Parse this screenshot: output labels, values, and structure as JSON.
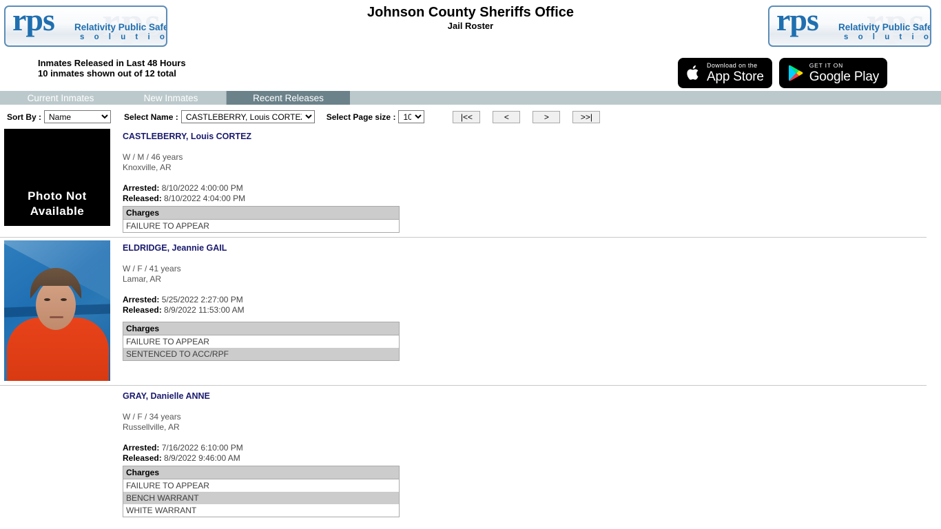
{
  "header": {
    "title": "Johnson County Sheriffs Office",
    "subtitle": "Jail Roster",
    "count_line_1": "Inmates Released in Last 48 Hours",
    "count_line_2": "10 inmates shown out of 12 total",
    "logo": {
      "mark": "rps",
      "ghost": "rps",
      "tagline_1": "Relativity Public Safety",
      "tagline_2": "s o l u t i o n s"
    },
    "badges": [
      {
        "small": "Download on the",
        "big": "App Store",
        "icon": "apple-icon"
      },
      {
        "small": "GET IT ON",
        "big": "Google Play",
        "icon": "google-play-icon"
      }
    ]
  },
  "tabs": [
    {
      "label": "Current Inmates",
      "active": false
    },
    {
      "label": "New Inmates",
      "active": false
    },
    {
      "label": "Recent Releases",
      "active": true
    }
  ],
  "toolbar": {
    "sort_by_label": "Sort By :",
    "sort_by_value": "Name",
    "select_name_label": "Select Name :",
    "select_name_value": "CASTLEBERRY, Louis CORTEZ",
    "page_size_label": "Select Page size :",
    "page_size_value": "10",
    "pager": {
      "first": "|<<",
      "prev": "<",
      "next": ">",
      "last": ">>|"
    }
  },
  "charges_header": "Charges",
  "photo_not_available": {
    "line1": "Photo Not",
    "line2": "Available"
  },
  "records": [
    {
      "name": "CASTLEBERRY, Louis CORTEZ",
      "demographics": "W / M / 46 years",
      "city": "Knoxville, AR",
      "arrested_label": "Arrested:",
      "arrested": "8/10/2022 4:00:00 PM",
      "released_label": "Released:",
      "released": "8/10/2022 4:04:00 PM",
      "has_photo": false,
      "charges": [
        "FAILURE TO APPEAR"
      ]
    },
    {
      "name": "ELDRIDGE, Jeannie GAIL",
      "demographics": "W / F / 41 years",
      "city": "Lamar, AR",
      "arrested_label": "Arrested:",
      "arrested": "5/25/2022 2:27:00 PM",
      "released_label": "Released:",
      "released": "8/9/2022 11:53:00 AM",
      "has_photo": true,
      "charges": [
        "FAILURE TO APPEAR",
        "SENTENCED TO ACC/RPF"
      ]
    },
    {
      "name": "GRAY, Danielle ANNE",
      "demographics": "W / F / 34 years",
      "city": "Russellville, AR",
      "arrested_label": "Arrested:",
      "arrested": "7/16/2022 6:10:00 PM",
      "released_label": "Released:",
      "released": "8/9/2022 9:46:00 AM",
      "has_photo": false,
      "no_photo_placeholder": true,
      "charges": [
        "FAILURE TO APPEAR",
        "BENCH WARRANT",
        "WHITE WARRANT"
      ]
    }
  ],
  "colors": {
    "tab_bar": "#bcc9cc",
    "tab_active": "#6b828a",
    "brand_blue": "#1f6fb0",
    "name_link": "#1a1a6e",
    "charges_header_bg": "#cccccc"
  }
}
